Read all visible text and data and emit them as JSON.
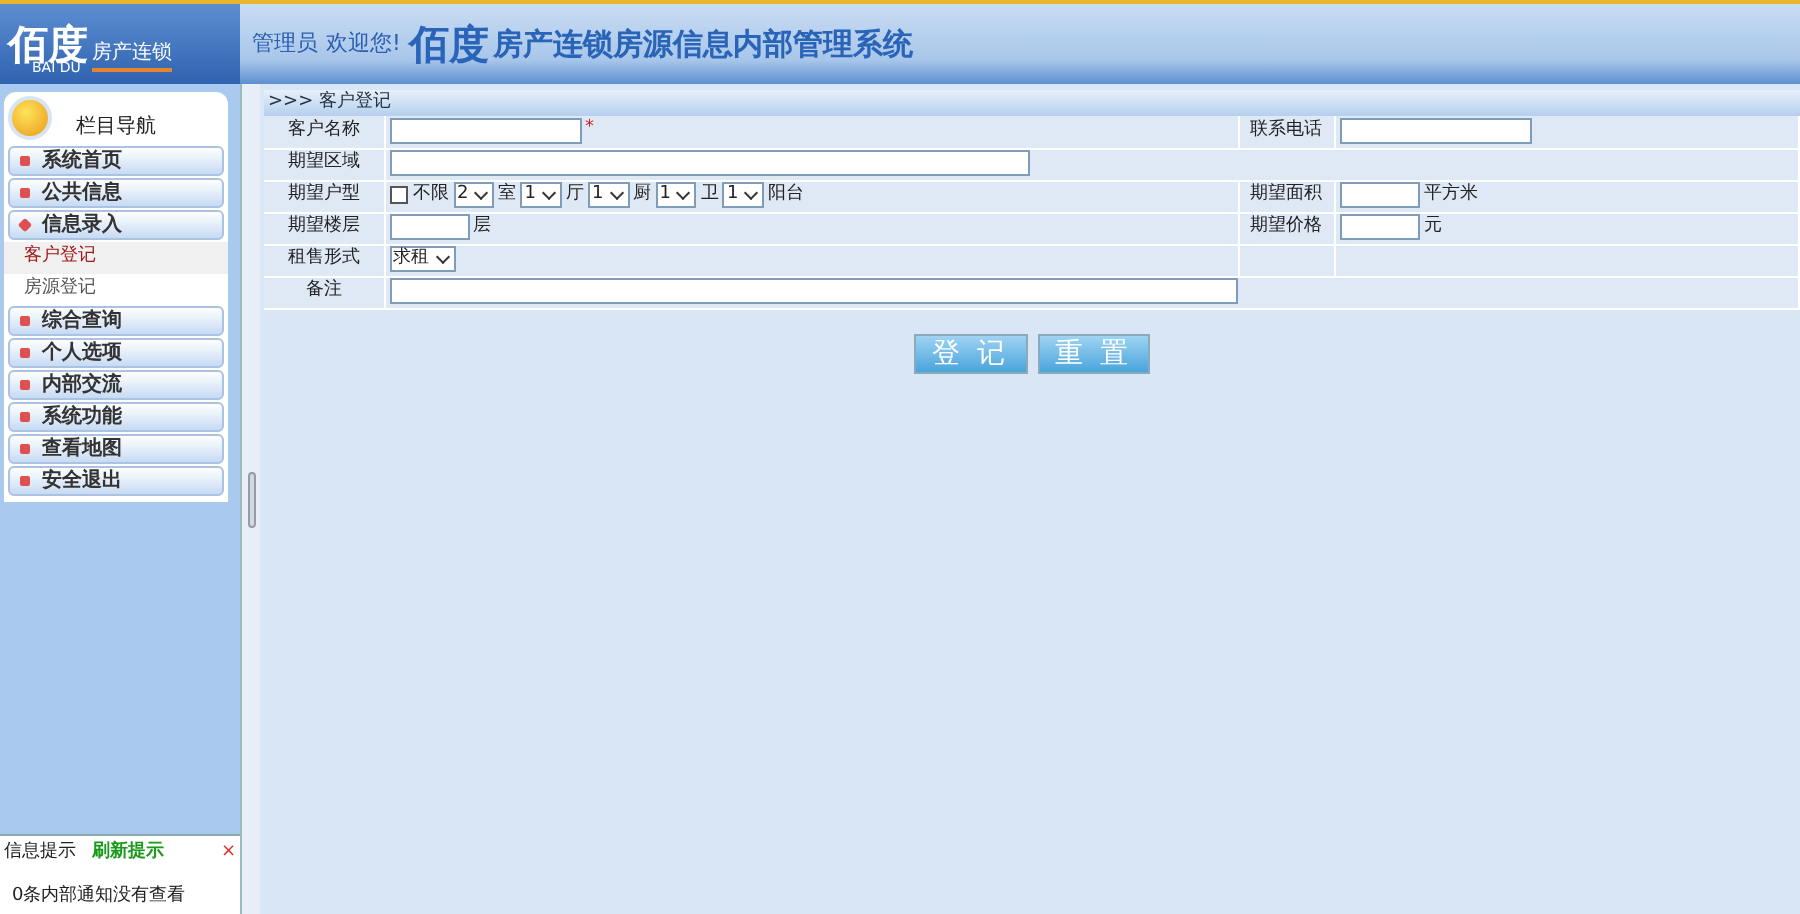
{
  "header": {
    "logo": "佰度",
    "logo_sub": "BAI DU",
    "logo_tag": "房产连锁",
    "user": "管理员",
    "welcome": "欢迎您!",
    "brand": "佰度",
    "title": "房产连锁房源信息内部管理系统"
  },
  "sidebar": {
    "title": "栏目导航",
    "items": [
      {
        "label": "系统首页",
        "expanded": false
      },
      {
        "label": "公共信息",
        "expanded": false
      },
      {
        "label": "信息录入",
        "expanded": true,
        "children": [
          {
            "label": "客户登记",
            "selected": true
          },
          {
            "label": "房源登记",
            "selected": false
          }
        ]
      },
      {
        "label": "综合查询",
        "expanded": false
      },
      {
        "label": "个人选项",
        "expanded": false
      },
      {
        "label": "内部交流",
        "expanded": false
      },
      {
        "label": "系统功能",
        "expanded": false
      },
      {
        "label": "查看地图",
        "expanded": false
      },
      {
        "label": "安全退出",
        "expanded": false
      }
    ]
  },
  "notice": {
    "tabs": [
      {
        "label": "信息提示",
        "selected": false
      },
      {
        "label": "刷新提示",
        "selected": true
      }
    ],
    "close": "×",
    "message": "0条内部通知没有查看"
  },
  "form": {
    "breadcrumb": ">>> 客户登记",
    "rows": [
      {
        "label": "客户名称",
        "parts": [
          {
            "kind": "input"
          },
          {
            "kind": "required",
            "text": "*"
          }
        ],
        "label2": "联系电话",
        "parts2": [
          {
            "kind": "input"
          }
        ]
      },
      {
        "label": "期望区域",
        "parts": [
          {
            "kind": "wide-input"
          }
        ]
      },
      {
        "label": "期望户型",
        "parts": [
          {
            "kind": "checkbox",
            "checked": false,
            "text": "不限"
          },
          {
            "kind": "select",
            "value": "2"
          },
          {
            "kind": "unit",
            "text": "室"
          },
          {
            "kind": "select",
            "value": "1"
          },
          {
            "kind": "unit",
            "text": "厅"
          },
          {
            "kind": "select",
            "value": "1"
          },
          {
            "kind": "unit",
            "text": "厨"
          },
          {
            "kind": "select",
            "value": "1"
          },
          {
            "kind": "unit",
            "text": "卫"
          },
          {
            "kind": "select",
            "value": "1"
          },
          {
            "kind": "unit",
            "text": "阳台"
          }
        ],
        "label2": "期望面积",
        "parts2": [
          {
            "kind": "short-input"
          },
          {
            "kind": "unit",
            "text": "平方米"
          }
        ]
      },
      {
        "label": "期望楼层",
        "parts": [
          {
            "kind": "short-input"
          },
          {
            "kind": "unit",
            "text": "层"
          }
        ],
        "label2": "期望价格",
        "parts2": [
          {
            "kind": "short-input"
          },
          {
            "kind": "unit",
            "text": "元"
          }
        ]
      },
      {
        "label": "租售形式",
        "parts": [
          {
            "kind": "select",
            "value": "求租"
          }
        ],
        "label2": "",
        "parts2": []
      },
      {
        "label": "备注",
        "parts": [
          {
            "kind": "remark-input"
          }
        ]
      }
    ],
    "buttons": [
      "登 记",
      "重 置"
    ]
  }
}
